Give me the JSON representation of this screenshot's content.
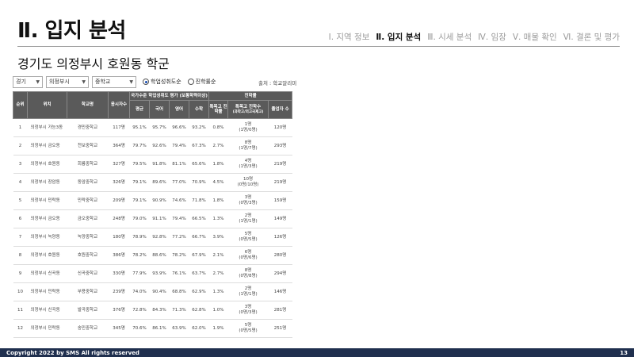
{
  "header": {
    "title": "Ⅱ. 입지 분석",
    "nav": [
      {
        "label": "Ⅰ. 지역 정보",
        "active": false
      },
      {
        "label": "Ⅱ. 입지 분석",
        "active": true
      },
      {
        "label": "Ⅲ. 시세 분석",
        "active": false
      },
      {
        "label": "Ⅳ. 임장",
        "active": false
      },
      {
        "label": "Ⅴ. 매물 확인",
        "active": false
      },
      {
        "label": "Ⅵ. 결론 및 평가",
        "active": false
      }
    ]
  },
  "subtitle": "경기도 의정부시 호원동 학군",
  "filters": {
    "province": "경기",
    "city": "의정부시",
    "school_level": "중학교",
    "radio_achievement": "학업성취도순",
    "radio_transfer": "진학률순",
    "source": "출처 : 학교알리미"
  },
  "table": {
    "headers": {
      "rank": "순위",
      "location": "위치",
      "school": "학교명",
      "applicants": "응시자수",
      "group_eval": "국가수준 학업성취도 평가 (보통학력이상)",
      "avg": "평균",
      "kor": "국어",
      "eng": "영어",
      "math": "수학",
      "group_transfer": "진학률",
      "special_rate": "특목고 진학률",
      "special_count": "특목고 진학수",
      "special_count_sub": "(과학고/외고국제고)",
      "grads": "졸업자 수"
    },
    "rows": [
      {
        "rank": "1",
        "loc": "의정부시 가능3동",
        "school": "경민중학교",
        "n": "117명",
        "avg": "95.1%",
        "kor": "95.7%",
        "eng": "96.6%",
        "math": "93.2%",
        "rate": "0.8%",
        "cnt": "1명",
        "sub": "(1명/0명)",
        "grad": "120명"
      },
      {
        "rank": "2",
        "loc": "의정부시 금오동",
        "school": "천보중학교",
        "n": "364명",
        "avg": "79.7%",
        "kor": "92.6%",
        "eng": "79.4%",
        "math": "67.3%",
        "rate": "2.7%",
        "cnt": "8명",
        "sub": "(1명/7명)",
        "grad": "293명"
      },
      {
        "rank": "3",
        "loc": "의정부시 호원동",
        "school": "회룡중학교",
        "n": "327명",
        "avg": "79.5%",
        "kor": "91.8%",
        "eng": "81.1%",
        "math": "65.6%",
        "rate": "1.8%",
        "cnt": "4명",
        "sub": "(1명/3명)",
        "grad": "219명"
      },
      {
        "rank": "4",
        "loc": "의정부시 장암동",
        "school": "동암중학교",
        "n": "326명",
        "avg": "79.1%",
        "kor": "89.6%",
        "eng": "77.0%",
        "math": "70.9%",
        "rate": "4.5%",
        "cnt": "10명",
        "sub": "(0명/10명)",
        "grad": "219명"
      },
      {
        "rank": "5",
        "loc": "의정부시 민락동",
        "school": "민락중학교",
        "n": "209명",
        "avg": "79.1%",
        "kor": "90.9%",
        "eng": "74.6%",
        "math": "71.8%",
        "rate": "1.8%",
        "cnt": "3명",
        "sub": "(0명/3명)",
        "grad": "159명"
      },
      {
        "rank": "6",
        "loc": "의정부시 금오동",
        "school": "금오중학교",
        "n": "248명",
        "avg": "79.0%",
        "kor": "91.1%",
        "eng": "79.4%",
        "math": "66.5%",
        "rate": "1.3%",
        "cnt": "2명",
        "sub": "(1명/1명)",
        "grad": "149명"
      },
      {
        "rank": "7",
        "loc": "의정부시 녹양동",
        "school": "녹양중학교",
        "n": "180명",
        "avg": "78.9%",
        "kor": "92.8%",
        "eng": "77.2%",
        "math": "66.7%",
        "rate": "3.9%",
        "cnt": "5명",
        "sub": "(0명/5명)",
        "grad": "126명"
      },
      {
        "rank": "8",
        "loc": "의정부시 호원동",
        "school": "호원중학교",
        "n": "386명",
        "avg": "78.2%",
        "kor": "88.6%",
        "eng": "78.2%",
        "math": "67.9%",
        "rate": "2.1%",
        "cnt": "6명",
        "sub": "(0명/6명)",
        "grad": "280명"
      },
      {
        "rank": "9",
        "loc": "의정부시 신곡동",
        "school": "신곡중학교",
        "n": "330명",
        "avg": "77.9%",
        "kor": "93.9%",
        "eng": "76.1%",
        "math": "63.7%",
        "rate": "2.7%",
        "cnt": "8명",
        "sub": "(0명/8명)",
        "grad": "294명"
      },
      {
        "rank": "10",
        "loc": "의정부시 민락동",
        "school": "부용중학교",
        "n": "239명",
        "avg": "74.0%",
        "kor": "90.4%",
        "eng": "68.8%",
        "math": "62.9%",
        "rate": "1.3%",
        "cnt": "2명",
        "sub": "(1명/1명)",
        "grad": "146명"
      },
      {
        "rank": "11",
        "loc": "의정부시 신곡동",
        "school": "발곡중학교",
        "n": "376명",
        "avg": "72.8%",
        "kor": "84.3%",
        "eng": "71.3%",
        "math": "62.8%",
        "rate": "1.0%",
        "cnt": "3명",
        "sub": "(0명/3명)",
        "grad": "281명"
      },
      {
        "rank": "12",
        "loc": "의정부시 민락동",
        "school": "송민중학교",
        "n": "345명",
        "avg": "70.6%",
        "kor": "86.1%",
        "eng": "63.9%",
        "math": "62.0%",
        "rate": "1.9%",
        "cnt": "5명",
        "sub": "(0명/5명)",
        "grad": "251명"
      }
    ]
  },
  "footer": {
    "copyright": "Copyright 2022 by SMS All rights reserved",
    "page": "13"
  }
}
